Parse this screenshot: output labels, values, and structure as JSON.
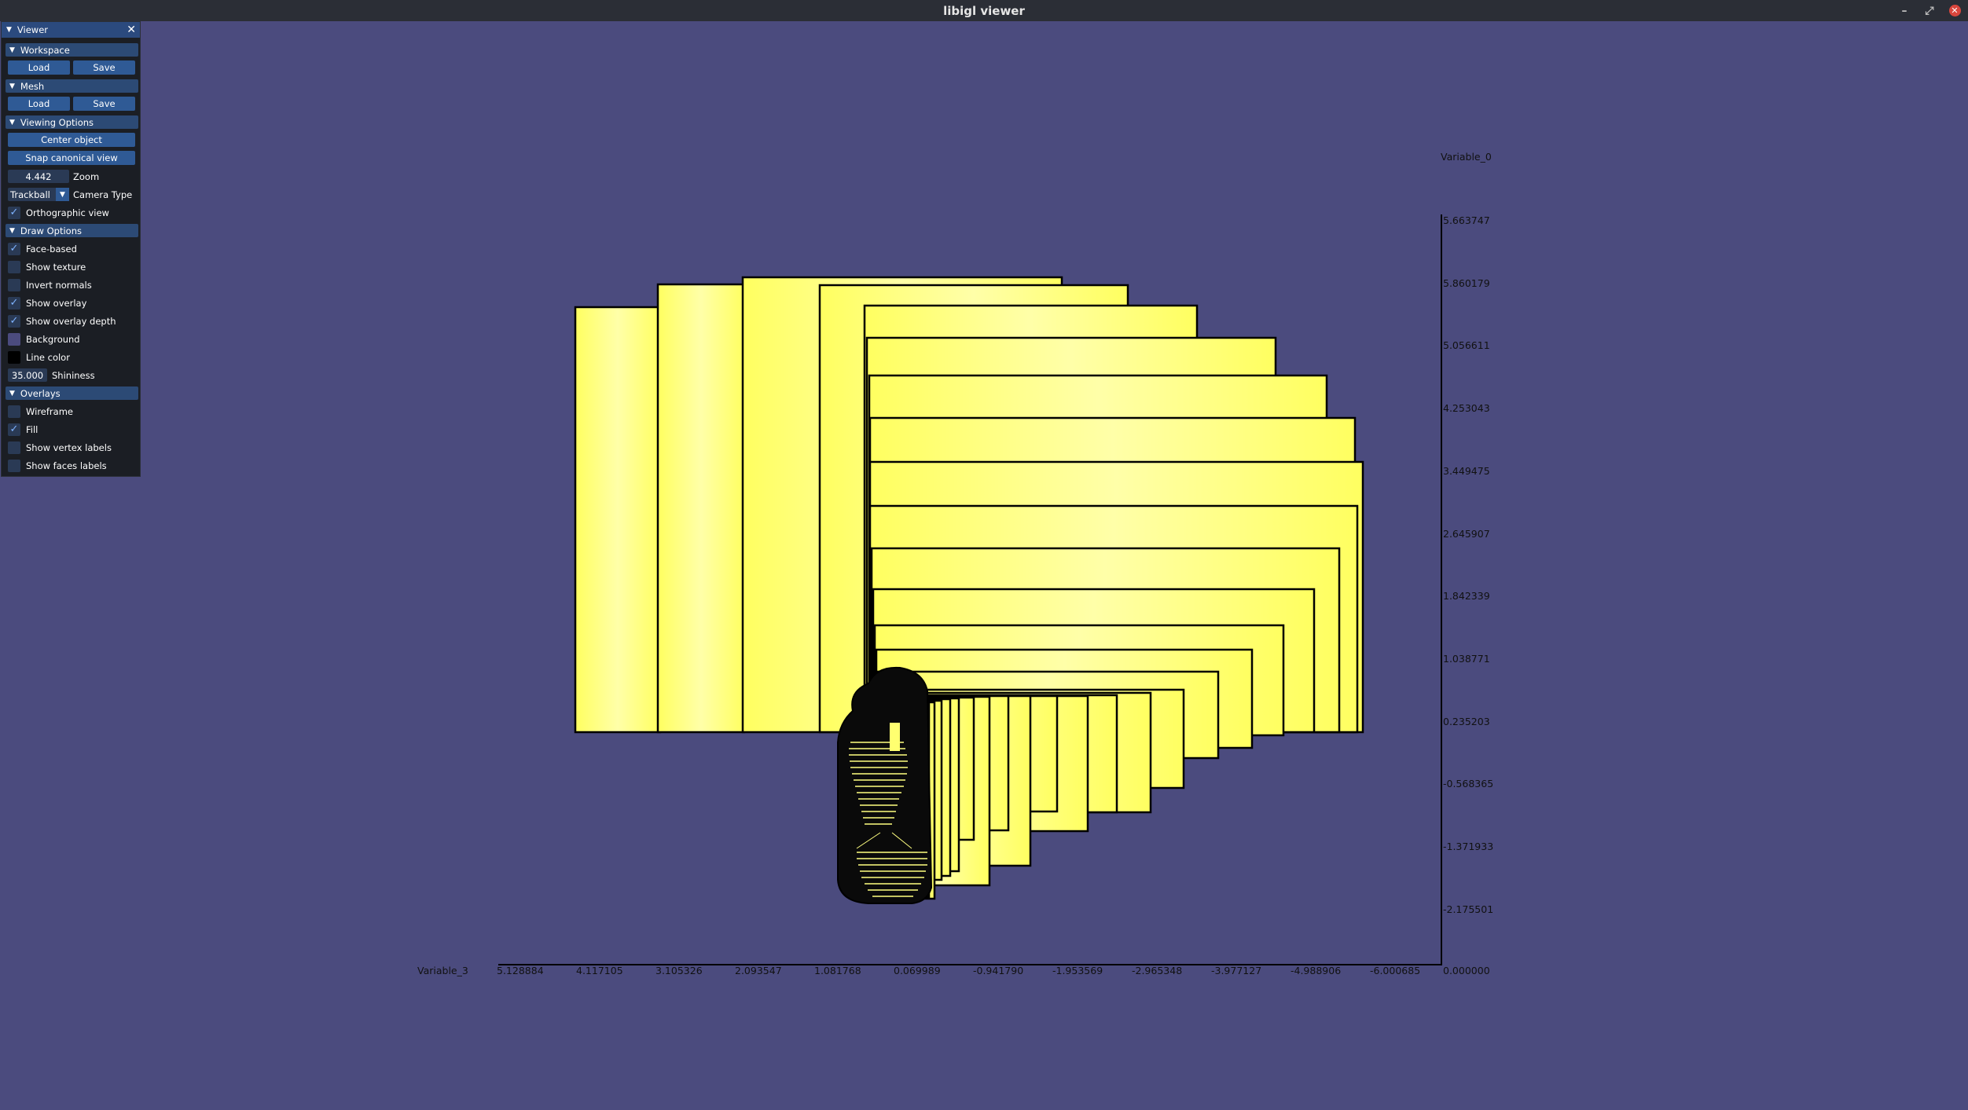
{
  "window": {
    "title": "libigl viewer",
    "minimize_icon": "minimize-icon",
    "maximize_icon": "maximize-icon",
    "close_icon": "close-icon"
  },
  "panel": {
    "title": "Viewer",
    "sections": {
      "workspace": {
        "title": "Workspace",
        "load": "Load",
        "save": "Save"
      },
      "mesh": {
        "title": "Mesh",
        "load": "Load",
        "save": "Save"
      },
      "viewing": {
        "title": "Viewing Options",
        "center": "Center object",
        "snap": "Snap canonical view",
        "zoom_value": "4.442",
        "zoom_label": "Zoom",
        "camera_value": "Trackball",
        "camera_label": "Camera Type",
        "ortho_label": "Orthographic view",
        "ortho_checked": true
      },
      "draw": {
        "title": "Draw Options",
        "face_based": "Face-based",
        "show_texture": "Show texture",
        "invert_normals": "Invert normals",
        "show_overlay": "Show overlay",
        "show_overlay_depth": "Show overlay depth",
        "background": "Background",
        "line_color": "Line color",
        "shininess_value": "35.000",
        "shininess_label": "Shininess",
        "background_color": "#4b4b7e",
        "line_color_value": "#000000"
      },
      "overlays": {
        "title": "Overlays",
        "wireframe": "Wireframe",
        "fill": "Fill",
        "vertex_labels": "Show vertex labels",
        "faces_labels": "Show faces labels"
      }
    }
  },
  "axes": {
    "y_title": "Variable_0",
    "x_title": "Variable_3",
    "y_ticks": [
      "5.663747",
      "5.860179",
      "5.056611",
      "4.253043",
      "3.449475",
      "2.645907",
      "1.842339",
      "1.038771",
      "0.235203",
      "-0.568365",
      "-1.371933",
      "-2.175501"
    ],
    "x_ticks": [
      "5.128884",
      "4.117105",
      "3.105326",
      "2.093547",
      "1.081768",
      "0.069989",
      "-0.941790",
      "-1.953569",
      "-2.965348",
      "-3.977127",
      "-4.988906",
      "-6.000685"
    ],
    "origin_label": "0.000000"
  },
  "colors": {
    "fill": "#ffff70",
    "fill_light": "#ffffb0",
    "edge": "#000000"
  }
}
